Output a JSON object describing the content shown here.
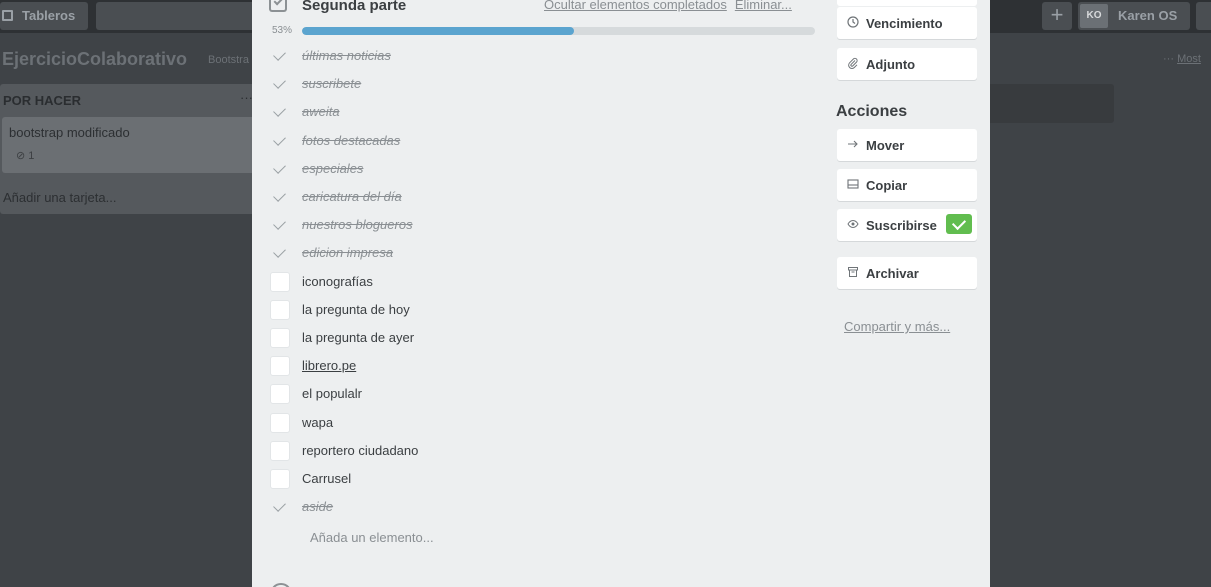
{
  "header": {
    "boards_label": "Tableros",
    "avatar_initials": "KO",
    "user_name": "Karen OS",
    "plus_symbol": "+"
  },
  "board": {
    "title": "EjercicioColaborativo",
    "tag": "Bootstra",
    "more_prefix": "···",
    "more_link": "Most"
  },
  "list": {
    "title": "POR HACER",
    "menu": "···",
    "card_title": "bootstrap modificado",
    "card_badge": "1",
    "add_card": "Añadir una tarjeta..."
  },
  "checklist": {
    "title": "Segunda parte",
    "hide_completed": "Ocultar elementos completados",
    "delete": "Eliminar...",
    "progress_label": "53%",
    "progress_fraction": 0.53,
    "items": [
      {
        "text": "últimas noticias",
        "done": true
      },
      {
        "text": "suscribete",
        "done": true
      },
      {
        "text": "aweita",
        "done": true
      },
      {
        "text": "fotos destacadas",
        "done": true
      },
      {
        "text": "especiales",
        "done": true
      },
      {
        "text": "caricatura del día",
        "done": true
      },
      {
        "text": "nuestros blogueros",
        "done": true
      },
      {
        "text": "edicion impresa",
        "done": true
      },
      {
        "text": "iconografías",
        "done": false
      },
      {
        "text": "la pregunta de hoy",
        "done": false
      },
      {
        "text": "la pregunta de ayer",
        "done": false
      },
      {
        "text": "librero.pe",
        "done": false,
        "link": true
      },
      {
        "text": "el populalr",
        "done": false
      },
      {
        "text": "wapa",
        "done": false
      },
      {
        "text": "reportero ciudadano",
        "done": false
      },
      {
        "text": "Carrusel",
        "done": false
      },
      {
        "text": "aside",
        "done": true
      }
    ],
    "add_item": "Añada un elemento..."
  },
  "sidebar": {
    "due_label": "Vencimiento",
    "attachment_label": "Adjunto",
    "actions_heading": "Acciones",
    "move_label": "Mover",
    "copy_label": "Copiar",
    "subscribe_label": "Suscribirse",
    "archive_label": "Archivar",
    "share_label": "Compartir y más...",
    "icons": [
      "clock-icon",
      "paperclip-icon",
      "arrow-right-icon",
      "copy-icon",
      "eye-icon",
      "archive-icon"
    ]
  },
  "colors": {
    "progress": "#5ba4cf",
    "subscribed": "#61bd4f"
  }
}
